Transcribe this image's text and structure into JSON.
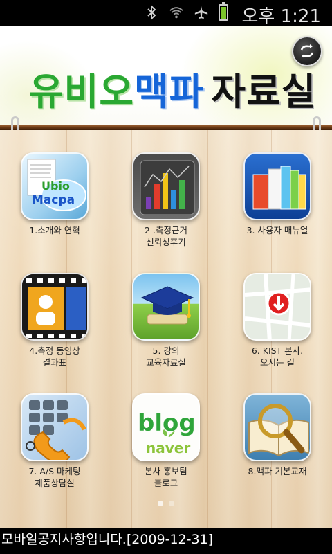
{
  "status_bar": {
    "time": "오후 1:21",
    "icons": [
      "bluetooth-icon",
      "wifi-icon",
      "airplane-mode-icon",
      "battery-icon"
    ],
    "battery_color": "#7cc52c"
  },
  "header": {
    "title_part1": "유비오",
    "title_part2": "맥파",
    "title_part3": "자료실",
    "refresh_icon": "refresh-icon"
  },
  "menu": [
    {
      "label": "1.소개와 연혁",
      "icon": "ubio-macpa-logo-icon"
    },
    {
      "label": "2 .측정근거\n신뢰성후기",
      "icon": "bar-chart-icon"
    },
    {
      "label": "3. 사용자 매뉴얼",
      "icon": "manual-books-icon"
    },
    {
      "label": "4.측정 동영상\n결과표",
      "icon": "film-strip-icon"
    },
    {
      "label": "5. 강의\n교육자료실",
      "icon": "graduation-cap-icon"
    },
    {
      "label": "6. KIST 본사.\n오시는 길",
      "icon": "map-pin-icon"
    },
    {
      "label": "7. A/S 마케팅\n제품상담실",
      "icon": "phone-keypad-icon"
    },
    {
      "label": "본사 홍보팀\n블로그",
      "icon": "naver-blog-icon"
    },
    {
      "label": "8.맥파 기본교재",
      "icon": "magnifier-book-icon"
    }
  ],
  "pager": {
    "pages": 2,
    "current": 1
  },
  "notice": {
    "text": "모바일공지사항입니다.[2009-12-31]"
  }
}
